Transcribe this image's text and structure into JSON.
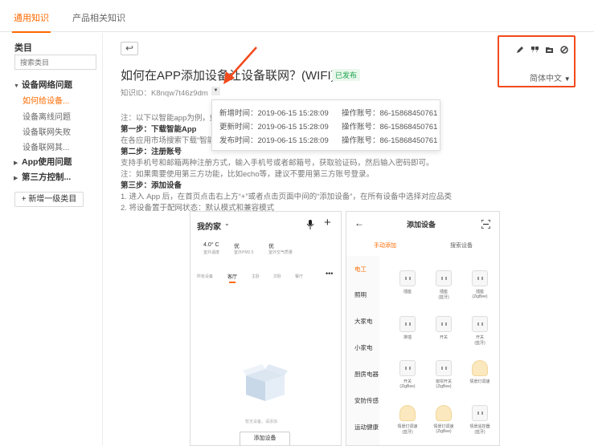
{
  "tabs": [
    {
      "label": "通用知识",
      "active": true
    },
    {
      "label": "产品相关知识",
      "active": false
    }
  ],
  "sidebar": {
    "title": "类目",
    "search_placeholder": "搜索类目",
    "groups": [
      {
        "label": "设备网络问题",
        "expanded": true,
        "items": [
          "如何给设备...",
          "设备离线问题",
          "设备联网失败",
          "设备联网其..."
        ]
      },
      {
        "label": "App使用问题",
        "expanded": false
      },
      {
        "label": "第三方控制...",
        "expanded": false
      }
    ],
    "add_button": "新增一级类目"
  },
  "article": {
    "back_icon": "back-arrow-icon",
    "title": "如何在APP添加设备让设备联网？(WIFI)",
    "status": "已发布",
    "id_label": "知识ID：",
    "id_value": "K8nqw7t46z9dm",
    "lines": [
      {
        "text": "注：以下以智能app为例，如",
        "bold": false
      },
      {
        "text": "第一步：下载智能App",
        "bold": true
      },
      {
        "text": "在各应用市场搜索下载“智能",
        "bold": false
      },
      {
        "text": "第二步：注册账号",
        "bold": true
      },
      {
        "text": "支持手机号和邮箱两种注册方式，输入手机号或者邮箱号，获取验证码，然后输入密码即可。",
        "bold": false
      },
      {
        "text": "注：如果需要使用第三方功能，比如echo等，建议不要用第三方账号登录。",
        "bold": false
      },
      {
        "text": "第三步：添加设备",
        "bold": true
      },
      {
        "text": "1. 进入 App 后，在首页点击右上方“+”或者点击页面中间的“添加设备”，在所有设备中选择对应品类",
        "bold": false
      },
      {
        "text": "2. 将设备置于配网状态：默认模式和兼容模式",
        "bold": false
      }
    ]
  },
  "popup": {
    "rows": [
      {
        "time_label": "新增时间：",
        "time": "2019-06-15 15:28:09",
        "acct_label": "操作账号：",
        "acct": "86-15868450761"
      },
      {
        "time_label": "更新时间：",
        "time": "2019-06-15 15:28:09",
        "acct_label": "操作账号：",
        "acct": "86-15868450761"
      },
      {
        "time_label": "发布时间：",
        "time": "2019-06-15 15:28:09",
        "acct_label": "操作账号：",
        "acct": "86-15868450761"
      }
    ]
  },
  "toolbar": {
    "icons": [
      "edit-icon",
      "quote-icon",
      "folder-icon",
      "disable-icon"
    ],
    "language": "简体中文"
  },
  "phone_home": {
    "title": "我的家",
    "temp": "4.0° C",
    "temp_label": "室外温度",
    "pm": "优",
    "pm_label": "室外PM2.5",
    "air": "优",
    "air_label": "室外空气质量",
    "rooms": [
      "所有设备",
      "客厅",
      "主卧",
      "次卧",
      "餐厅"
    ],
    "active_room": "客厅",
    "empty_text": "暂无设备，请添加",
    "add_button": "添加设备"
  },
  "phone_add": {
    "title": "添加设备",
    "tab_manual": "手动添加",
    "tab_search": "搜索设备",
    "categories": [
      "电工",
      "照明",
      "大家电",
      "小家电",
      "厨房电器",
      "安防传感",
      "运动健康"
    ],
    "active_category": "电工",
    "devices": [
      {
        "name": "插座",
        "sub": ""
      },
      {
        "name": "插座",
        "sub": "(蓝牙)"
      },
      {
        "name": "插座",
        "sub": "(ZigBee)"
      },
      {
        "name": "排插",
        "sub": ""
      },
      {
        "name": "开关",
        "sub": ""
      },
      {
        "name": "开关",
        "sub": "(蓝牙)"
      },
      {
        "name": "开关",
        "sub": "(ZigBee)"
      },
      {
        "name": "窗帘开关",
        "sub": "(ZigBee)"
      },
      {
        "name": "情景灯调速",
        "sub": ""
      },
      {
        "name": "情景灯调速",
        "sub": "(蓝牙)"
      },
      {
        "name": "情景灯调速",
        "sub": "(ZigBee)"
      },
      {
        "name": "情景遥控器",
        "sub": "(蓝牙)"
      }
    ]
  },
  "colors": {
    "accent": "#ff6a00",
    "highlight_box": "#f24a1c",
    "published": "#1aa34a"
  }
}
